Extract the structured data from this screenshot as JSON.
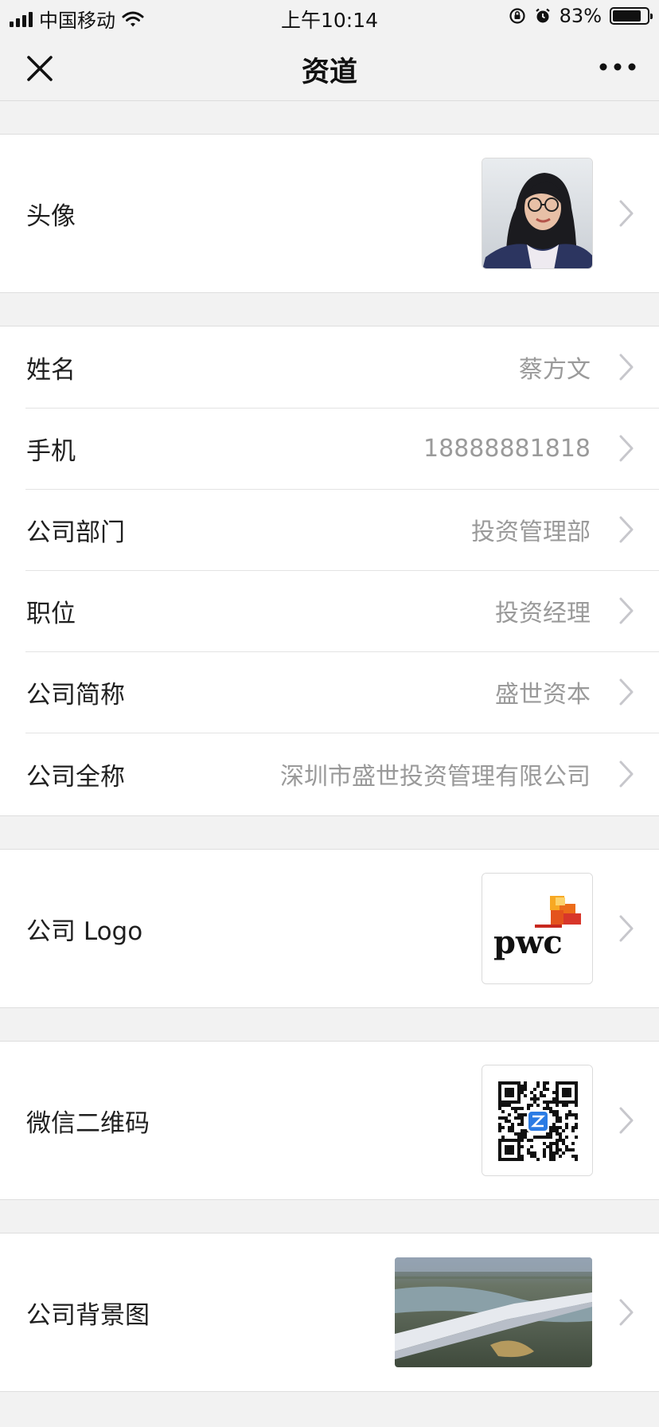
{
  "status_bar": {
    "carrier": "中国移动",
    "time": "上午10:14",
    "battery_percent": "83%",
    "battery_level": 0.83
  },
  "nav": {
    "title": "资道",
    "close_icon": "close-icon",
    "more_icon": "more-icon"
  },
  "profile": {
    "avatar_label": "头像",
    "name_label": "姓名",
    "name_value": "蔡方文",
    "phone_label": "手机",
    "phone_value": "18888881818",
    "department_label": "公司部门",
    "department_value": "投资管理部",
    "position_label": "职位",
    "position_value": "投资经理",
    "company_short_label": "公司简称",
    "company_short_value": "盛世资本",
    "company_full_label": "公司全称",
    "company_full_value": "深圳市盛世投资管理有限公司",
    "logo_label": "公司 Logo",
    "logo_text": "pwc",
    "qrcode_label": "微信二维码",
    "background_label": "公司背景图"
  },
  "colors": {
    "background": "#f2f2f2",
    "value_text": "#9a9a9a",
    "pwc_orange": "#e8701a",
    "pwc_red": "#c8281e",
    "qr_badge": "#2a7be4"
  }
}
